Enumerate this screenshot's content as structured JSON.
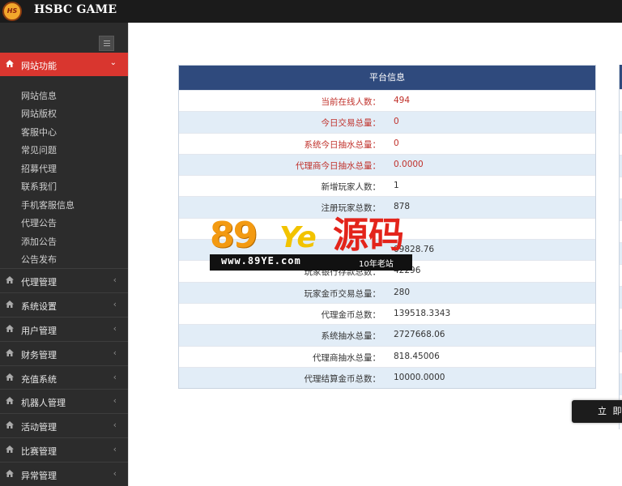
{
  "brand": {
    "logo_text": "HS",
    "name": "HSBC GAME"
  },
  "sidebar": {
    "active": {
      "label": "网站功能"
    },
    "submenu": [
      "网站信息",
      "网站版权",
      "客服中心",
      "常见问题",
      "招募代理",
      "联系我们",
      "手机客服信息",
      "代理公告",
      "添加公告",
      "公告发布"
    ],
    "items": [
      "代理管理",
      "系统设置",
      "用户管理",
      "财务管理",
      "充值系统",
      "机器人管理",
      "活动管理",
      "比赛管理",
      "异常管理"
    ]
  },
  "table": {
    "title": "平台信息",
    "rows": [
      {
        "label": "当前在线人数：",
        "value": "494"
      },
      {
        "label": "今日交易总量：",
        "value": "0"
      },
      {
        "label": "系统今日抽水总量：",
        "value": "0"
      },
      {
        "label": "代理商今日抽水总量：",
        "value": "0.0000"
      },
      {
        "label": "新增玩家人数：",
        "value": "1"
      },
      {
        "label": "注册玩家总数：",
        "value": "878"
      },
      {
        "label": "",
        "value": ""
      },
      {
        "label": "",
        "value": "09828.76"
      },
      {
        "label": "玩家银行存款总数：",
        "value": "42296"
      },
      {
        "label": "玩家金币交易总量：",
        "value": "280"
      },
      {
        "label": "代理金币总数：",
        "value": "139518.3343"
      },
      {
        "label": "系统抽水总量：",
        "value": "2727668.06"
      },
      {
        "label": "代理商抽水总量：",
        "value": "818.45006"
      },
      {
        "label": "代理结算金币总数：",
        "value": "10000.0000"
      }
    ]
  },
  "submit": {
    "label": "立 即 更"
  },
  "watermark": {
    "digits": "89",
    "ye": "Ye",
    "yuanma": "源码",
    "url": "www.89YE.com",
    "tag": "10年老站"
  },
  "colors": {
    "accent_red": "#d9362f",
    "header_blue": "#2f4a7d",
    "row_alt": "#e2edf7",
    "value_red": "#c0312b"
  }
}
